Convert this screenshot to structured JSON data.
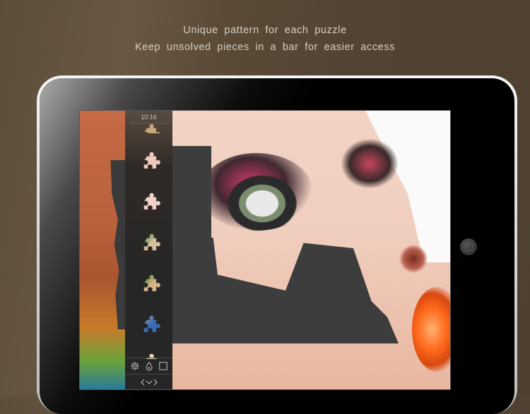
{
  "captions": {
    "line1": "Unique pattern for each puzzle",
    "line2": "Keep unsolved pieces in a bar for easier access"
  },
  "device": {
    "type": "tablet",
    "home_button_icon": "home-button-icon"
  },
  "game": {
    "status_bar": {
      "time": "10:16"
    },
    "piece_bar": {
      "pieces": [
        {
          "id": 1,
          "color": "#c9a57a",
          "partial": true
        },
        {
          "id": 2,
          "color": "#f0c9bd"
        },
        {
          "id": 3,
          "color": "#f2d1c6"
        },
        {
          "id": 4,
          "color": "#d8c0a0",
          "accent": "#3d8a3a"
        },
        {
          "id": 5,
          "color": "#d6b48a",
          "accent": "#2d8a2a"
        },
        {
          "id": 6,
          "color": "#3a6ab8",
          "accent": "#9aa0a8"
        },
        {
          "id": 7,
          "color": "#e9dcc0",
          "partial": true
        }
      ],
      "tools": [
        {
          "name": "settings",
          "icon": "gear-icon",
          "glyph": "⚙"
        },
        {
          "name": "background-color",
          "icon": "drop-icon",
          "glyph": "💧"
        },
        {
          "name": "preview",
          "icon": "square-icon",
          "glyph": "□"
        }
      ],
      "collapse_label": "‹‹›",
      "collapse_icon": "chevrons-icon"
    },
    "board": {
      "colors": {
        "background": "#3d3d3d",
        "skin": "#f0cfc0",
        "lips": "#ff6a1c"
      }
    }
  }
}
